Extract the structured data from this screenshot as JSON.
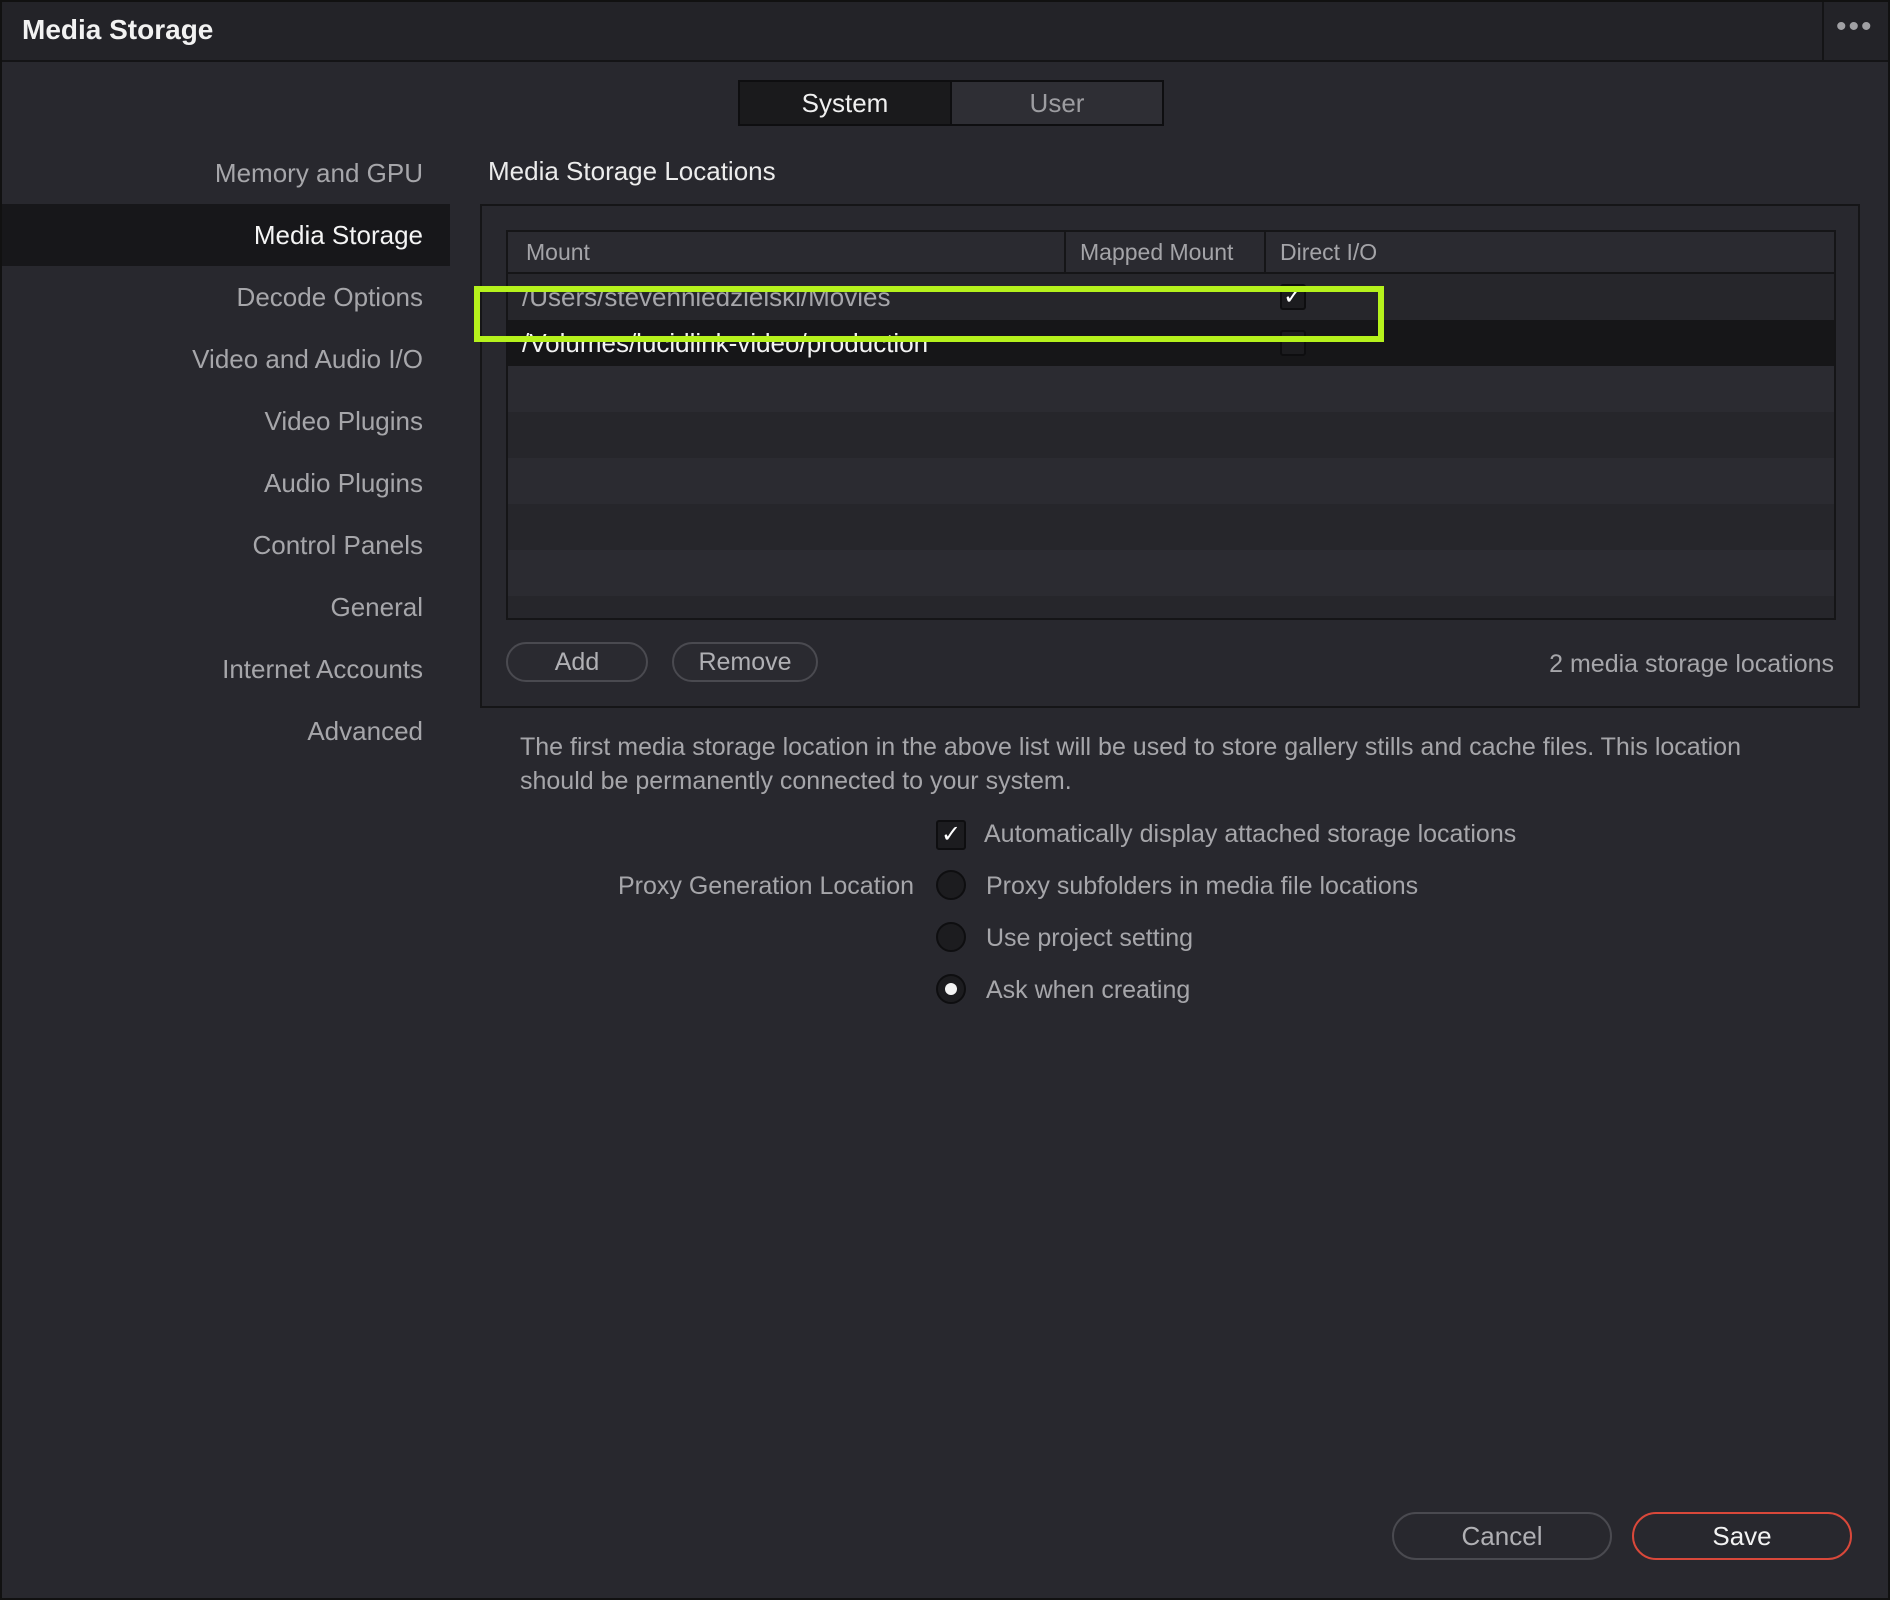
{
  "window": {
    "title": "Media Storage",
    "more_glyph": "•••"
  },
  "tabs": {
    "system": "System",
    "user": "User",
    "selected": "System"
  },
  "sidebar": {
    "items": [
      {
        "label": "Memory and GPU",
        "active": false
      },
      {
        "label": "Media Storage",
        "active": true
      },
      {
        "label": "Decode Options",
        "active": false
      },
      {
        "label": "Video and Audio I/O",
        "active": false
      },
      {
        "label": "Video Plugins",
        "active": false
      },
      {
        "label": "Audio Plugins",
        "active": false
      },
      {
        "label": "Control Panels",
        "active": false
      },
      {
        "label": "General",
        "active": false
      },
      {
        "label": "Internet Accounts",
        "active": false
      },
      {
        "label": "Advanced",
        "active": false
      }
    ]
  },
  "main": {
    "section_title": "Media Storage Locations",
    "table": {
      "columns": [
        "Mount",
        "Mapped Mount",
        "Direct I/O"
      ],
      "rows": [
        {
          "mount": "/Users/stevenniedzielski/Movies",
          "mapped_mount": "",
          "direct_io": true
        },
        {
          "mount": "/Volumes/lucidlink-video/production",
          "mapped_mount": "",
          "direct_io": false,
          "selected": true
        }
      ]
    },
    "add_label": "Add",
    "remove_label": "Remove",
    "count_text": "2 media storage locations",
    "info_text": "The first media storage location in the above list will be used to store gallery stills and cache files. This location should be permanently connected to your system.",
    "auto_display": {
      "label": "Automatically display attached storage locations",
      "checked": true
    },
    "proxy": {
      "label": "Proxy Generation Location",
      "options": [
        {
          "label": "Proxy subfolders in media file locations",
          "selected": false
        },
        {
          "label": "Use project setting",
          "selected": false
        },
        {
          "label": "Ask when creating",
          "selected": true
        }
      ]
    }
  },
  "footer": {
    "cancel_label": "Cancel",
    "save_label": "Save"
  },
  "colors": {
    "highlight": "#b5f21c",
    "save_border": "#d9483a",
    "background": "#28282e"
  }
}
